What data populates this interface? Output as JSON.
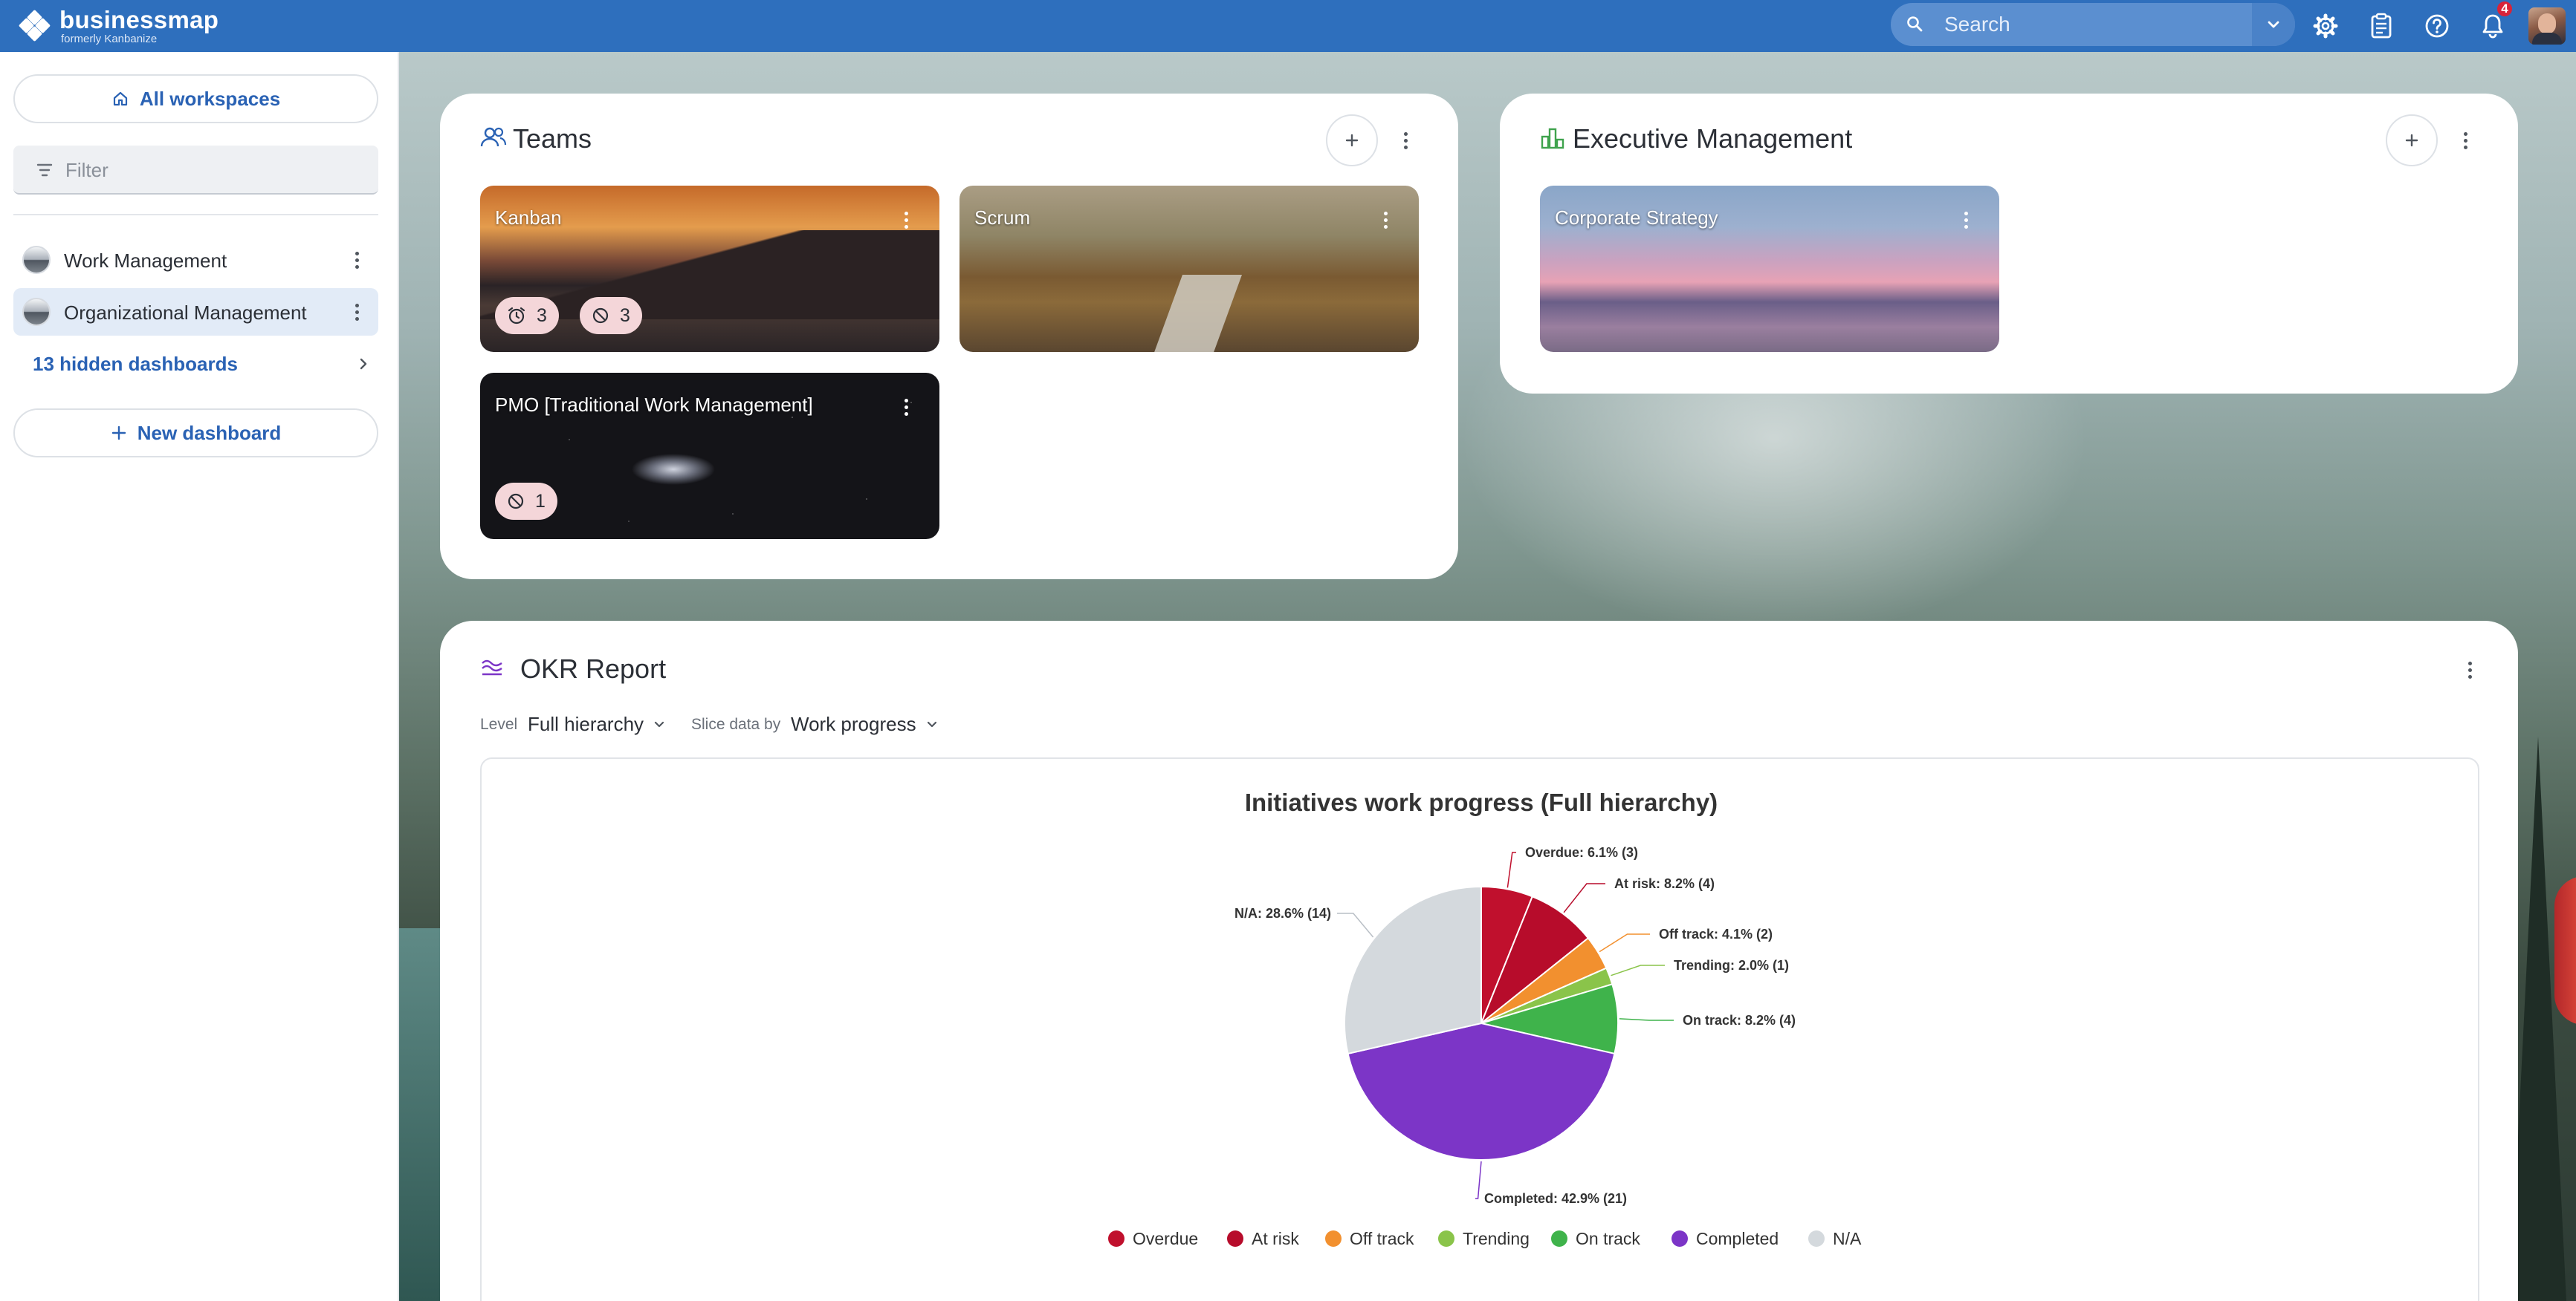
{
  "app": {
    "logo_name": "businessmap",
    "logo_sub": "formerly Kanbanize",
    "brand_color": "#2e6fbd"
  },
  "topbar": {
    "search_placeholder": "Search",
    "icons": [
      "search-icon",
      "chevron-down-icon",
      "gear-icon",
      "clipboard-icon",
      "help-icon",
      "bell-icon"
    ],
    "notification_count": "4"
  },
  "sidebar": {
    "all_workspaces": "All workspaces",
    "filter_placeholder": "Filter",
    "workspaces": [
      {
        "label": "Work Management",
        "active": false
      },
      {
        "label": "Organizational Management",
        "active": true
      }
    ],
    "hidden_dashboards": "13 hidden dashboards",
    "new_dashboard": "New dashboard"
  },
  "teams": {
    "title": "Teams",
    "boards": [
      {
        "name": "Kanban",
        "chips": [
          {
            "icon": "alarm-icon",
            "count": "3"
          },
          {
            "icon": "blocked-icon",
            "count": "3"
          }
        ]
      },
      {
        "name": "Scrum",
        "chips": []
      },
      {
        "name": "PMO [Traditional Work Management]",
        "chips": [
          {
            "icon": "blocked-icon",
            "count": "1"
          }
        ]
      }
    ]
  },
  "executive": {
    "title": "Executive Management",
    "boards": [
      {
        "name": "Corporate Strategy"
      }
    ]
  },
  "okr": {
    "title": "OKR Report",
    "level_label": "Level",
    "level_value": "Full hierarchy",
    "slice_label": "Slice data by",
    "slice_value": "Work progress"
  },
  "chart_data": {
    "type": "pie",
    "title": "Initiatives work progress (Full hierarchy)",
    "slices": [
      {
        "name": "Overdue",
        "percent": 6.1,
        "count": 3,
        "label": "Overdue: 6.1% (3)",
        "color": "#c0102d"
      },
      {
        "name": "At risk",
        "percent": 8.2,
        "count": 4,
        "label": "At risk: 8.2% (4)",
        "color": "#b70c2b"
      },
      {
        "name": "Off track",
        "percent": 4.1,
        "count": 2,
        "label": "Off track: 4.1% (2)",
        "color": "#f2902f"
      },
      {
        "name": "Trending",
        "percent": 2.0,
        "count": 1,
        "label": "Trending: 2.0% (1)",
        "color": "#8ac44a"
      },
      {
        "name": "On track",
        "percent": 8.2,
        "count": 4,
        "label": "On track: 8.2% (4)",
        "color": "#3fb34b"
      },
      {
        "name": "Completed",
        "percent": 42.9,
        "count": 21,
        "label": "Completed: 42.9% (21)",
        "color": "#7c35c7"
      },
      {
        "name": "N/A",
        "percent": 28.6,
        "count": 14,
        "label": "N/A: 28.6% (14)",
        "color": "#d4d9dd"
      }
    ],
    "legend": [
      "Overdue",
      "At risk",
      "Off track",
      "Trending",
      "On track",
      "Completed",
      "N/A"
    ],
    "legend_position": "bottom"
  }
}
